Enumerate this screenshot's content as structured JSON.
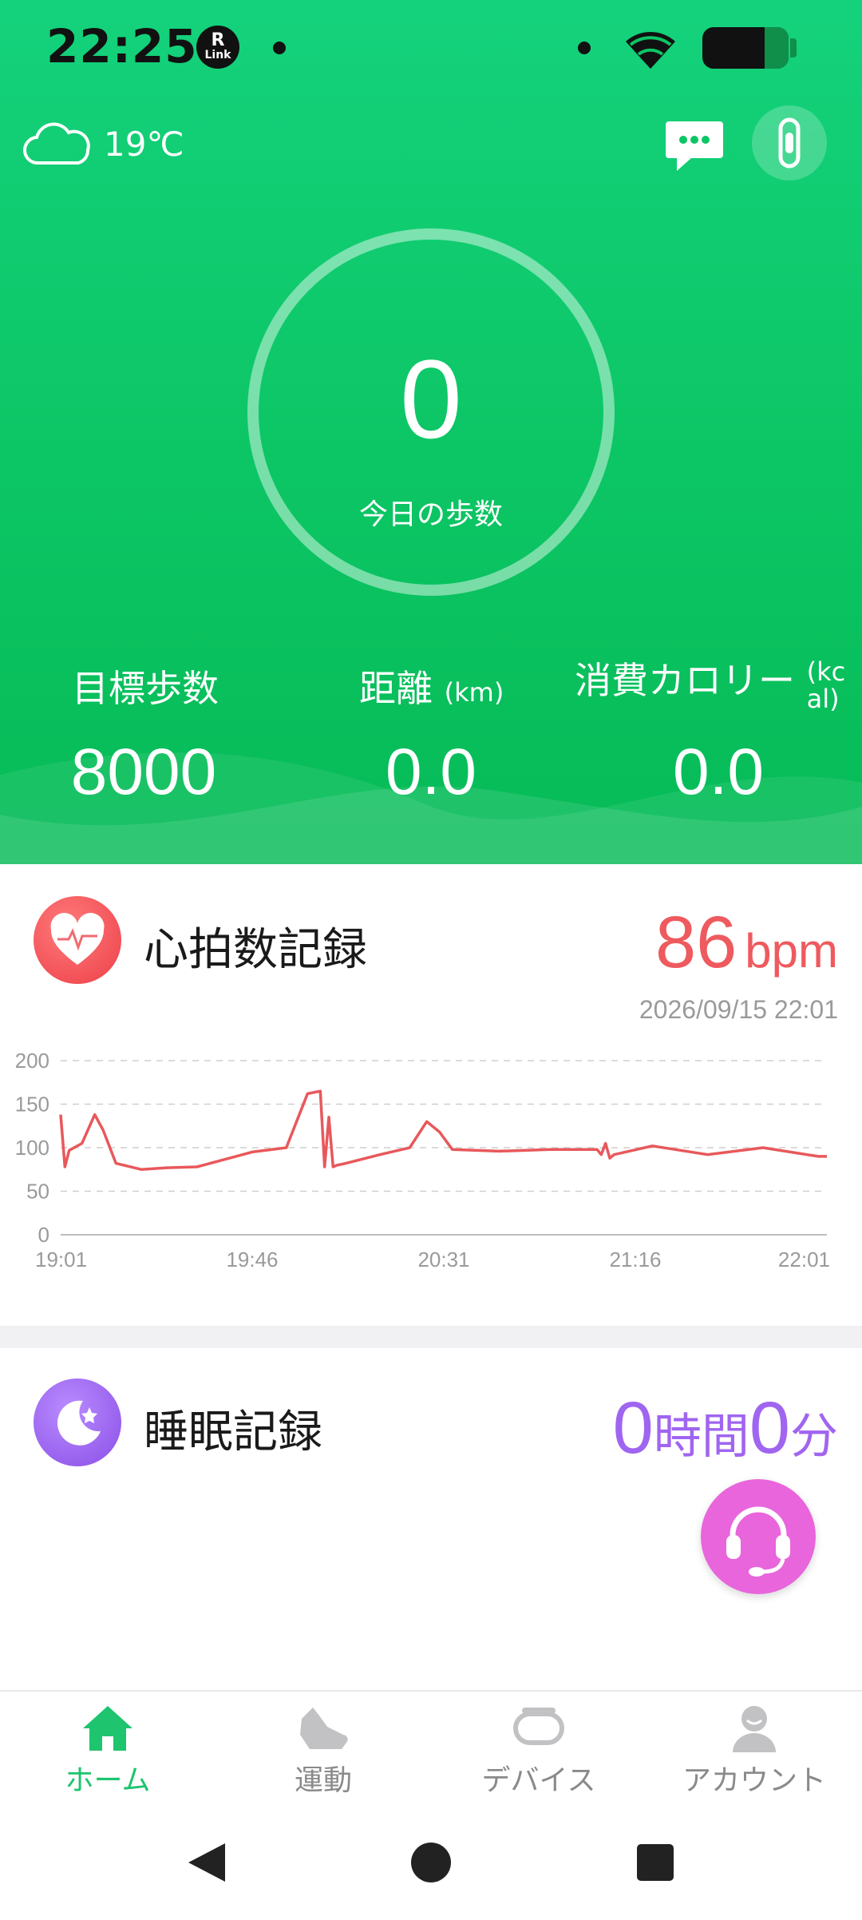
{
  "status_bar": {
    "time": "22:25",
    "rlink_badge_top": "R",
    "rlink_badge_bottom": "Link"
  },
  "header": {
    "weather_icon": "cloud-icon",
    "temperature": "19℃",
    "message_icon": "chat-bubble-icon",
    "device_icon": "smartwatch-icon",
    "today_steps": {
      "value": "0",
      "label": "今日の歩数"
    },
    "stats": [
      {
        "label": "目標歩数",
        "unit": "",
        "value": "8000"
      },
      {
        "label": "距離",
        "unit": "(km)",
        "value": "0.0"
      },
      {
        "label": "消費カロリー",
        "unit": "(kcal)",
        "value": "0.0"
      }
    ]
  },
  "heart_card": {
    "title": "心拍数記録",
    "value": "86",
    "unit": "bpm",
    "timestamp": "2026/09/15 22:01"
  },
  "sleep_card": {
    "title": "睡眠記録",
    "hours": "0",
    "hours_unit": "時間",
    "minutes": "0",
    "minutes_unit": "分",
    "support_icon": "headset-icon"
  },
  "bottom_nav": [
    {
      "label": "ホーム",
      "icon": "home-icon",
      "active": true
    },
    {
      "label": "運動",
      "icon": "sneaker-icon",
      "active": false
    },
    {
      "label": "デバイス",
      "icon": "watch-band-icon",
      "active": false
    },
    {
      "label": "アカウント",
      "icon": "user-icon",
      "active": false
    }
  ],
  "colors": {
    "primary_green": "#0cc564",
    "heart_red": "#ee5a5e",
    "sleep_purple": "#a065f0",
    "support_pink": "#e865dc"
  },
  "chart_data": {
    "type": "line",
    "title": "",
    "xlabel": "",
    "ylabel": "",
    "ylim": [
      0,
      200
    ],
    "yticks": [
      0,
      50,
      100,
      150,
      200
    ],
    "xtick_labels": [
      "19:01",
      "19:46",
      "20:31",
      "21:16",
      "22:01"
    ],
    "grid": true,
    "series": [
      {
        "color": "#e8585b",
        "x": [
          "19:01",
          "19:02",
          "19:03",
          "19:06",
          "19:09",
          "19:11",
          "19:14",
          "19:20",
          "19:26",
          "19:33",
          "19:46",
          "19:54",
          "19:59",
          "20:02",
          "20:03",
          "20:04",
          "20:05",
          "20:06",
          "20:08",
          "20:16",
          "20:23",
          "20:27",
          "20:30",
          "20:33",
          "20:44",
          "20:56",
          "21:07",
          "21:08",
          "21:09",
          "21:10",
          "21:11",
          "21:20",
          "21:33",
          "21:46",
          "21:59",
          "22:01"
        ],
        "y": [
          138,
          78,
          97,
          105,
          138,
          120,
          82,
          75,
          77,
          78,
          95,
          100,
          162,
          165,
          78,
          135,
          78,
          80,
          82,
          92,
          100,
          130,
          118,
          98,
          96,
          98,
          98,
          92,
          105,
          88,
          92,
          102,
          92,
          100,
          90,
          90
        ]
      }
    ]
  }
}
